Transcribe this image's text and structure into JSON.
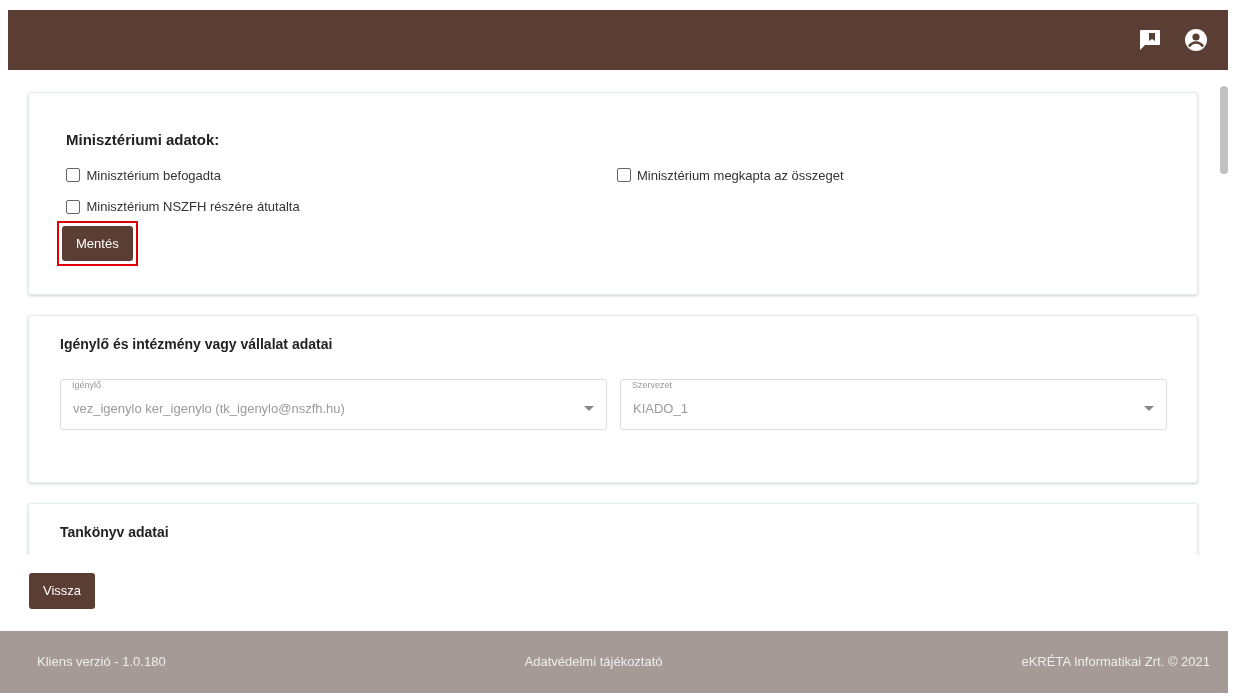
{
  "ministry": {
    "title": "Minisztériumi adatok:",
    "checkboxes": [
      {
        "label": "Minisztérium befogadta",
        "checked": false
      },
      {
        "label": "Minisztérium megkapta az összeget",
        "checked": false
      },
      {
        "label": "Minisztérium NSZFH részére átutalta",
        "checked": false
      }
    ],
    "save_button": {
      "label": "Mentés",
      "highlighted": true
    }
  },
  "requester": {
    "title": "Igénylő és intézmény vagy vállalat adatai",
    "fields": [
      {
        "label": "Igénylő",
        "value": "vez_igenylo ker_igenylo (tk_igenylo@nszfh.hu)",
        "disabled": true
      },
      {
        "label": "Szervezet",
        "value": "KIADO_1",
        "disabled": true
      }
    ]
  },
  "textbook": {
    "title": "Tankönyv adatai"
  },
  "back_button": "Vissza",
  "footer": {
    "version": "Kliens verzió - 1.0.180",
    "privacy": "Adatvédelmi tájékoztató",
    "copyright": "eKRÉTA Informatikai Zrt. © 2021"
  }
}
